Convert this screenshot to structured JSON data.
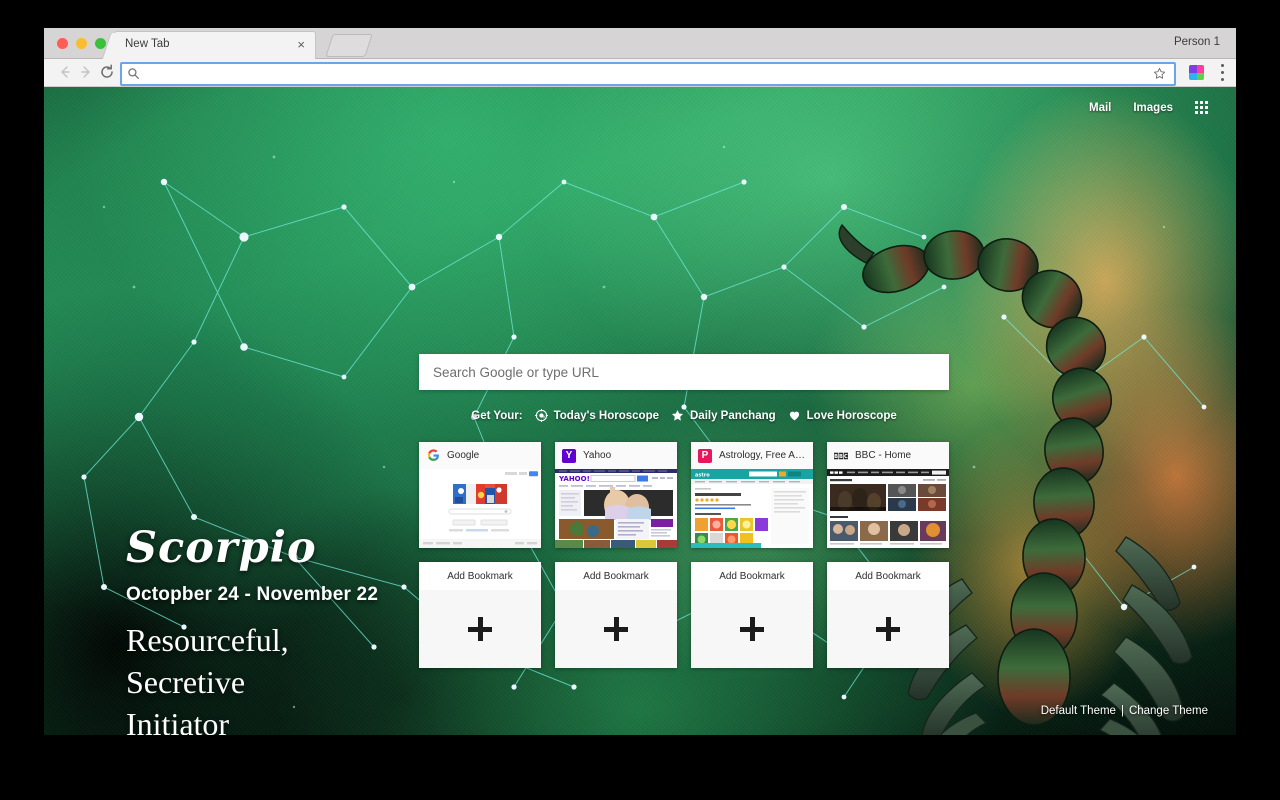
{
  "browser": {
    "tab_title": "New Tab",
    "tab_close_label": "×",
    "profile_label": "Person 1",
    "new_tab_button_label": "",
    "address_value": "",
    "address_placeholder": ""
  },
  "topnav": {
    "mail": "Mail",
    "images": "Images",
    "apps_icon": "apps-grid-icon"
  },
  "search": {
    "value": "",
    "placeholder": "Search Google or type URL"
  },
  "get_your": {
    "label": "Get Your:",
    "items": [
      {
        "label": "Today's Horoscope",
        "icon": "target-gear-icon"
      },
      {
        "label": "Daily Panchang",
        "icon": "star-icon"
      },
      {
        "label": "Love Horoscope",
        "icon": "heart-icon"
      }
    ]
  },
  "tiles": [
    {
      "title": "Google",
      "favicon": "google-g-icon",
      "favicon_text": "G",
      "favicon_color": "#ffffff"
    },
    {
      "title": "Yahoo",
      "favicon": "yahoo-y-icon",
      "favicon_text": "Y",
      "favicon_color": "#6001d2"
    },
    {
      "title": "Astrology, Free Astr...",
      "favicon": "astrology-p-icon",
      "favicon_text": "P",
      "favicon_color": "#e8175d"
    },
    {
      "title": "BBC - Home",
      "favicon": "bbc-icon",
      "favicon_text": "BBC",
      "favicon_color": "#2b2b2b"
    }
  ],
  "add_bookmarks": [
    {
      "label": "Add Bookmark",
      "plus": "+"
    },
    {
      "label": "Add Bookmark",
      "plus": "+"
    },
    {
      "label": "Add Bookmark",
      "plus": "+"
    },
    {
      "label": "Add Bookmark",
      "plus": "+"
    }
  ],
  "sign": {
    "name": "Scorpio",
    "dates": "Octopber 24 - November 22",
    "trait_line_1": "Resourceful,",
    "trait_line_2": "Secretive",
    "trait_line_3": "Initiator"
  },
  "theme": {
    "default_label": "Default Theme",
    "separator": "|",
    "change_label": "Change Theme"
  },
  "colors": {
    "theme_green": "#2b9a5c",
    "nebula_orange": "#ec5c1e",
    "omnibox_focus": "#6ba5e7",
    "traffic_red": "#fc5d55",
    "traffic_yellow": "#f9bd2e",
    "traffic_green": "#3ac03a"
  }
}
